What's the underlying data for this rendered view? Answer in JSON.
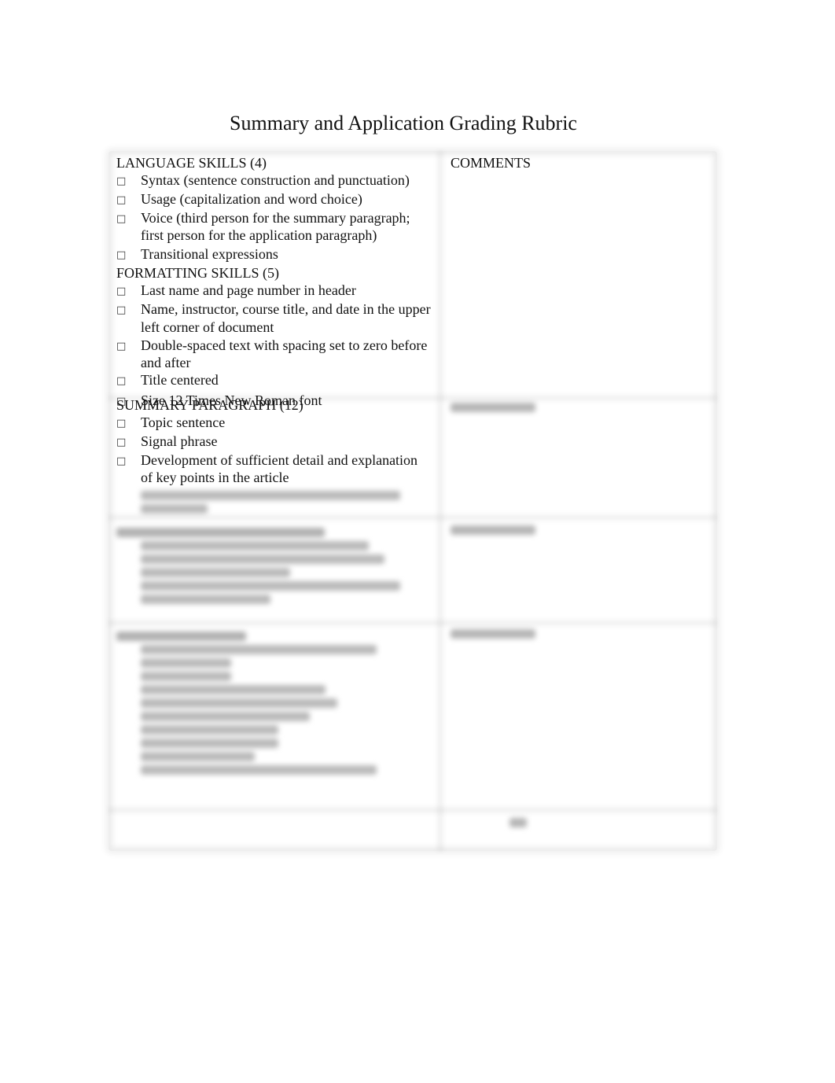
{
  "document": {
    "title": "Summary and Application Grading Rubric"
  },
  "rubric": {
    "comments_label": "COMMENTS",
    "sections": [
      {
        "heading": "LANGUAGE SKILLS (4)",
        "items": [
          "Syntax (sentence construction and punctuation)",
          "Usage (capitalization and word choice)",
          "Voice (third person for the summary paragraph; first person for the application paragraph)",
          "Transitional expressions"
        ]
      },
      {
        "heading": "FORMATTING SKILLS (5)",
        "items": [
          "Last name and page number in header",
          "Name, instructor, course title, and date in the upper left corner of document",
          "Double-spaced text with spacing set to zero before and after",
          "Title centered",
          "Size 12 Times New Roman font"
        ]
      },
      {
        "heading": "SUMMARY PARAGRAPH (12)",
        "items": [
          "Topic sentence",
          "Signal phrase",
          "Development of sufficient detail and explanation of key points in the article"
        ]
      }
    ],
    "bullet_icon": ""
  }
}
